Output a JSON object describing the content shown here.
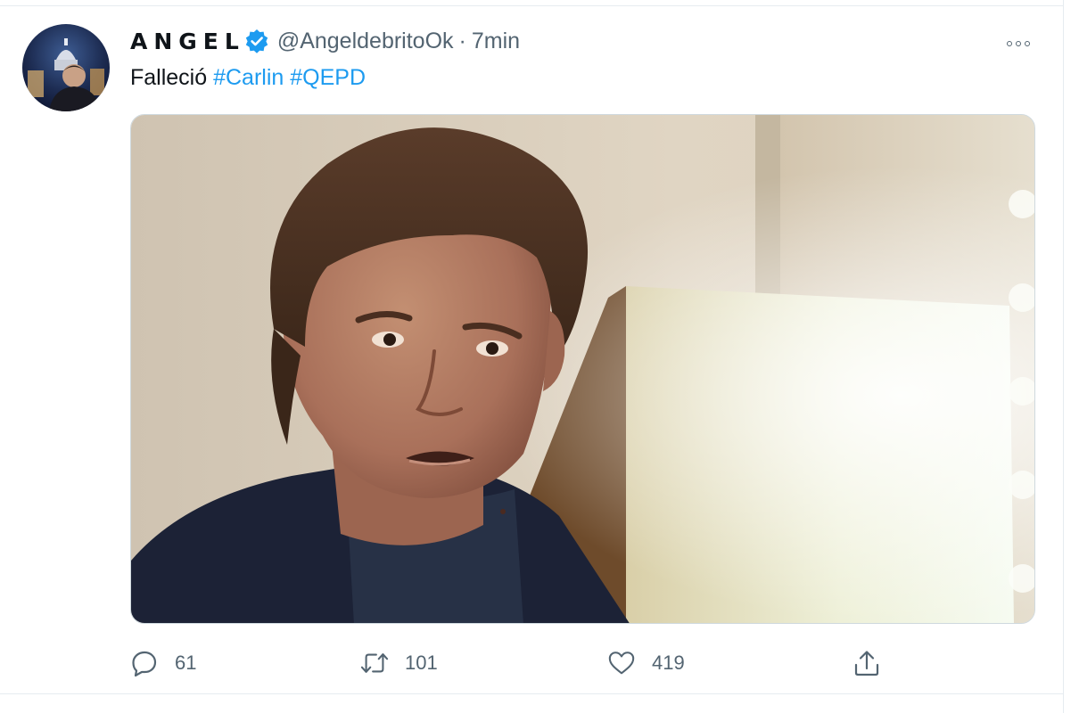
{
  "tweet": {
    "author": {
      "display_name": "ANGEL",
      "handle": "@AngeldebritoOk",
      "verified": true
    },
    "separator": "·",
    "time": "7min",
    "text": {
      "prefix": "Falleció ",
      "hashtags": [
        "#Carlin",
        "#QEPD"
      ]
    },
    "actions": {
      "reply_count": "61",
      "retweet_count": "101",
      "like_count": "419"
    }
  },
  "icons": {
    "verified": "verified-badge-icon",
    "more": "more-options-icon",
    "reply": "reply-icon",
    "retweet": "retweet-icon",
    "like": "heart-icon",
    "share": "share-icon"
  },
  "colors": {
    "accent": "#1d9bf0",
    "secondary_text": "#536471",
    "primary_text": "#0f1419",
    "border": "#e6ecf0"
  }
}
